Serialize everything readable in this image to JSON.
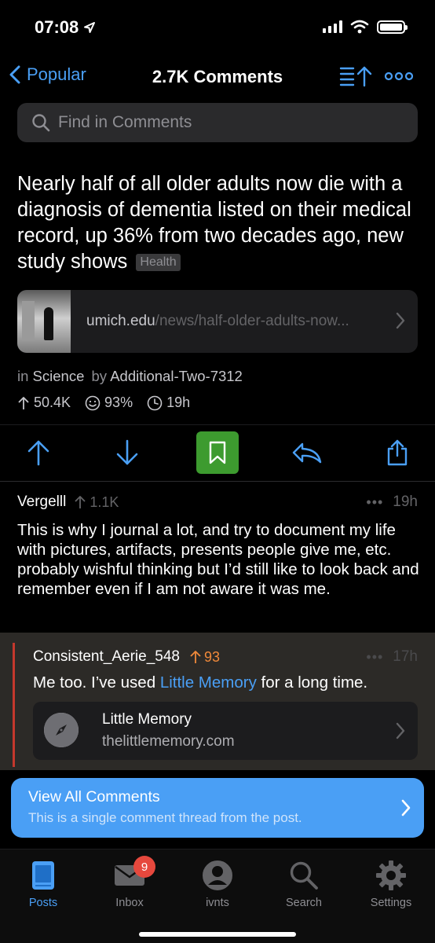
{
  "status": {
    "time": "07:08"
  },
  "nav": {
    "back_label": "Popular",
    "title": "2.7K Comments"
  },
  "search": {
    "placeholder": "Find in Comments"
  },
  "post": {
    "title": "Nearly half of all older adults now die with a diagnosis of dementia listed on their medical record, up 36% from two decades ago, new study shows",
    "flair": "Health",
    "link_domain": "umich.edu",
    "link_path": "/news/half-older-adults-now...",
    "in_label": "in",
    "subreddit": "Science",
    "by_label": "by",
    "author": "Additional-Two-7312",
    "upvotes": "50.4K",
    "ratio": "93%",
    "age": "19h"
  },
  "comment": {
    "author": "Vergelll",
    "score": "1.1K",
    "time": "19h",
    "body": "This is why I journal a lot, and try to document my life with pictures, artifacts, presents people give me, etc. probably wishful thinking but I’d still like to look back and remember even if I am not aware it was me."
  },
  "reply": {
    "author": "Consistent_Aerie_548",
    "score": "93",
    "time": "17h",
    "body_before": "Me too. I’ve used ",
    "body_link": "Little Memory",
    "body_after": " for a long time.",
    "card_title": "Little Memory",
    "card_url": "thelittlememory.com"
  },
  "banner": {
    "title": "View All Comments",
    "subtitle": "This is a single comment thread from the post."
  },
  "tabs": [
    {
      "label": "Posts",
      "icon": "posts-icon"
    },
    {
      "label": "Inbox",
      "icon": "mail-icon",
      "badge": "9"
    },
    {
      "label": "ivnts",
      "icon": "profile-icon"
    },
    {
      "label": "Search",
      "icon": "search-icon"
    },
    {
      "label": "Settings",
      "icon": "gear-icon"
    }
  ],
  "colors": {
    "accent": "#4a9ff5",
    "bookmark_active": "#3d9b2f",
    "upvote_orange": "#f0893a",
    "thread_bar": "#c4382d",
    "badge": "#e6483d"
  }
}
